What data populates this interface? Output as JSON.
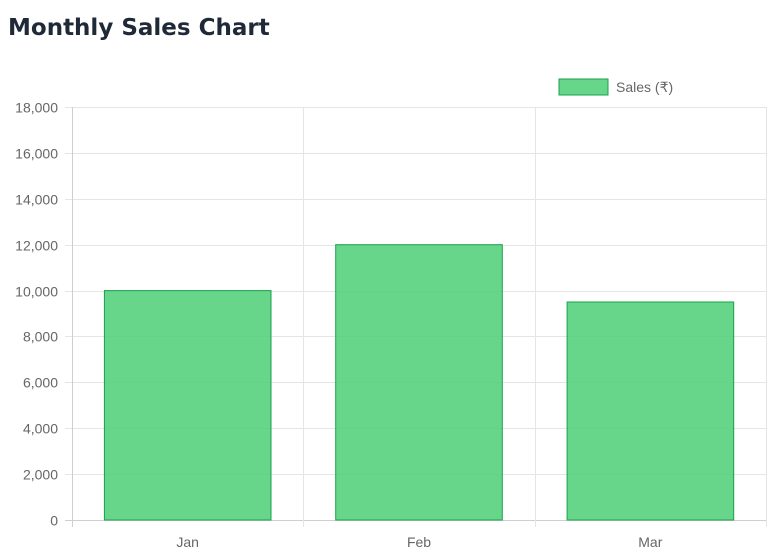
{
  "page": {
    "title": "Monthly Sales Chart"
  },
  "chart_data": {
    "type": "bar",
    "categories": [
      "Jan",
      "Feb",
      "Mar"
    ],
    "series": [
      {
        "name": "Sales (₹)",
        "values": [
          10000,
          12000,
          9500
        ],
        "fill": "#4ecf78",
        "stroke": "#16a34a"
      }
    ],
    "ylim": [
      0,
      18000
    ],
    "yticks": [
      0,
      2000,
      4000,
      6000,
      8000,
      10000,
      12000,
      14000,
      16000,
      18000
    ],
    "ytick_labels": [
      "0",
      "2,000",
      "4,000",
      "6,000",
      "8,000",
      "10,000",
      "12,000",
      "14,000",
      "16,000",
      "18,000"
    ],
    "grid": true,
    "legend": "top-right"
  }
}
